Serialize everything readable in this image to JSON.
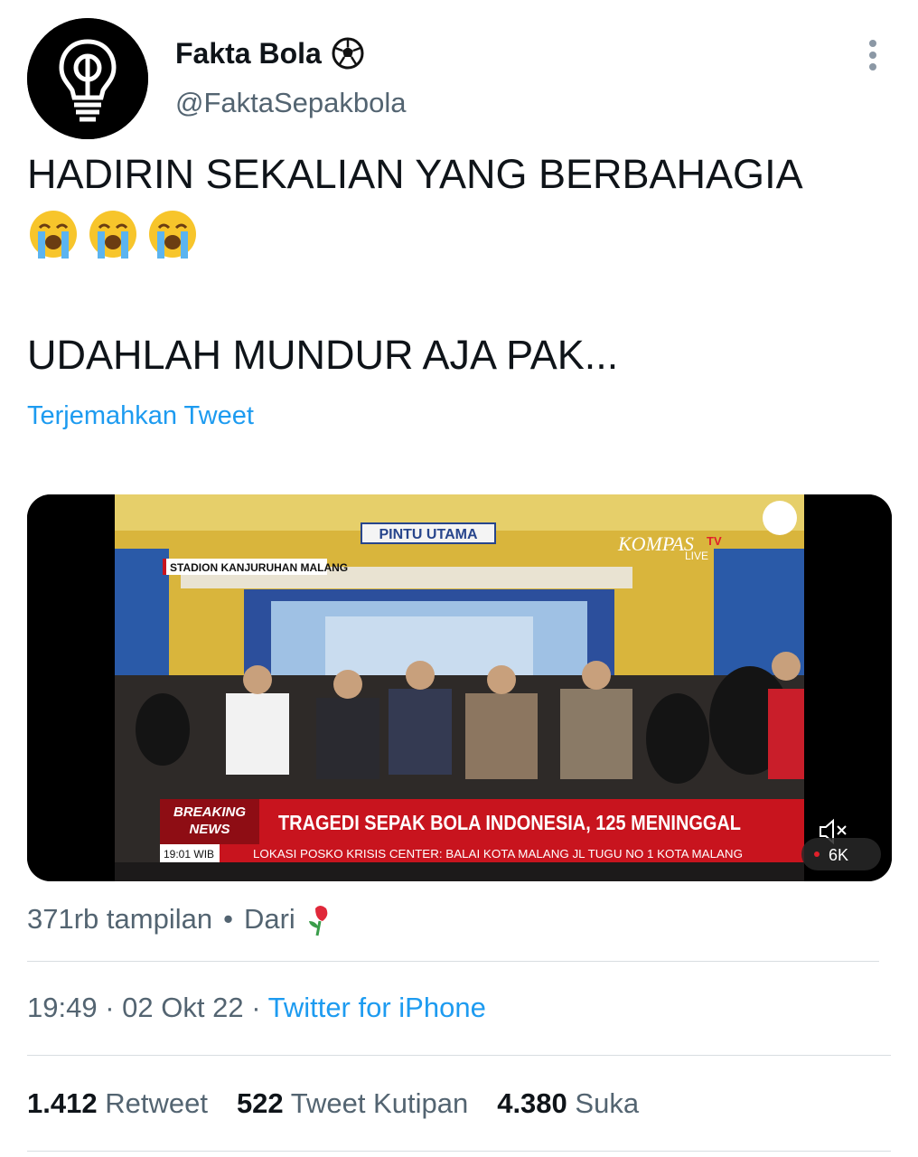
{
  "author": {
    "display_name": "Fakta Bola",
    "badge_icon": "soccer-ball-icon",
    "handle": "@FaktaSepakbola",
    "avatar_icon": "lightbulb-icon"
  },
  "tweet": {
    "line1": "HADIRIN SEKALIAN YANG BERBAHAGIA",
    "emojis": [
      "loudly-crying-face",
      "loudly-crying-face",
      "loudly-crying-face"
    ],
    "line2": "UDAHLAH MUNDUR AJA PAK...",
    "translate_label": "Terjemahkan Tweet"
  },
  "media": {
    "sign_text": "PINTU UTAMA",
    "location_tag": "STADION KANJURUHAN MALANG",
    "channel_logo": "KOMPAS",
    "channel_tv": "TV",
    "channel_live": "LIVE",
    "breaking_label_1": "BREAKING",
    "breaking_label_2": "NEWS",
    "headline": "TRAGEDI SEPAK BOLA INDONESIA, 125 MENINGGAL",
    "time_tag": "19:01 WIB",
    "ticker": "LOKASI POSKO KRISIS CENTER: BALAI KOTA MALANG JL TUGU NO 1 KOTA MALANG",
    "view_count": "6K",
    "mute_icon": "speaker-muted-icon"
  },
  "views": {
    "text": "371rb tampilan",
    "separator": "•",
    "from_label": "Dari",
    "from_icon": "rose-icon"
  },
  "meta": {
    "time": "19:49",
    "date": "02 Okt 22",
    "dot": "·",
    "source": "Twitter for iPhone"
  },
  "stats": {
    "retweets_count": "1.412",
    "retweets_label": "Retweet",
    "quotes_count": "522",
    "quotes_label": "Tweet Kutipan",
    "likes_count": "4.380",
    "likes_label": "Suka"
  },
  "colors": {
    "link": "#1d9bf0",
    "secondary_text": "#536471",
    "primary_text": "#0f1419",
    "breaking_red": "#c8141e"
  }
}
